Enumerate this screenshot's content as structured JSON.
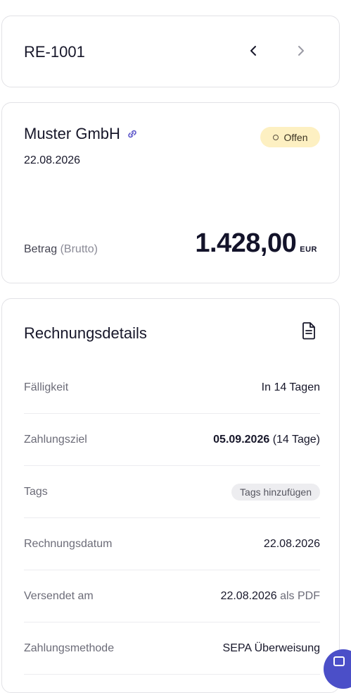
{
  "header": {
    "document_id": "RE-1001"
  },
  "summary": {
    "customer": "Muster GmbH",
    "date": "22.08.2026",
    "status": "Offen",
    "amount_label": "Betrag",
    "amount_label_suffix": "(Brutto)",
    "amount": "1.428,00",
    "currency": "EUR"
  },
  "details": {
    "title": "Rechnungsdetails",
    "rows": [
      {
        "label": "Fälligkeit",
        "value": "In 14 Tagen"
      },
      {
        "label": "Zahlungsziel",
        "value_bold": "05.09.2026",
        "value_extra": "(14 Tage)"
      },
      {
        "label": "Tags",
        "button": "Tags hinzufügen"
      },
      {
        "label": "Rechnungsdatum",
        "value": "22.08.2026"
      },
      {
        "label": "Versendet am",
        "value": "22.08.2026",
        "value_grey": "als PDF"
      },
      {
        "label": "Zahlungsmethode",
        "value": "SEPA Überweisung"
      }
    ]
  },
  "colors": {
    "accent": "#4b4fc8",
    "status_bg": "#fdf0c2",
    "border": "#e2e2e6"
  }
}
